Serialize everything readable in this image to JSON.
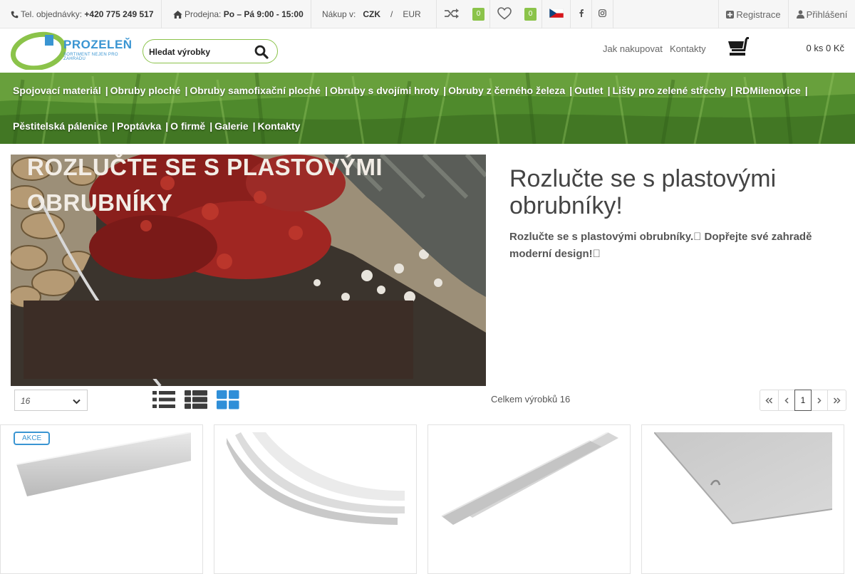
{
  "topbar": {
    "phone_label": "Tel. objednávky:",
    "phone_number": "+420 775 249 517",
    "shop_label": "Prodejna:",
    "shop_hours": "Po – Pá 9:00 - 15:00",
    "currency_label": "Nákup v:",
    "currency_selected": "CZK",
    "currency_separator": "/",
    "currency_other": "EUR",
    "compare_count": "0",
    "wishlist_count": "0",
    "register_label": "Registrace",
    "login_label": "Přihlášení"
  },
  "header": {
    "logo_name": "PROZELEŇ",
    "logo_tagline": "SORTIMENT NEJEN PRO ZAHRADU",
    "search_placeholder": "Hledat výrobky",
    "links": [
      "Jak nakupovat",
      "Kontakty"
    ],
    "cart_summary": "0 ks 0 Kč"
  },
  "menu": {
    "row1": [
      "Spojovací materiál",
      "Obruby ploché",
      "Obruby samofixační ploché",
      "Obruby s dvojími hroty",
      "Obruby z černého železa",
      "Outlet",
      "Lišty pro zelené střechy",
      "RDMilenovice"
    ],
    "row2": [
      "Pěstitelská pálenice",
      "Poptávka",
      "O firmě",
      "Galerie",
      "Kontakty"
    ],
    "separator": "|"
  },
  "hero": {
    "banner_line1": "ROZLUČTE SE S PLASTOVÝMI",
    "banner_line2": "OBRUBNÍKY",
    "title": "Rozlučte se s plastovými obrubníky!",
    "subtitle": "Rozlučte se s plastovými obrubníky.\u0000 Dopřejte své zahradě moderní design!\u0000"
  },
  "listing": {
    "per_page": "16",
    "total_label": "Celkem výrobků 16",
    "current_page": "1"
  },
  "products": [
    {
      "badge": "AKCE",
      "icon": "flat-edging-strip"
    },
    {
      "badge": "",
      "icon": "curved-edging-strips"
    },
    {
      "badge": "",
      "icon": "straight-edging-strips"
    },
    {
      "badge": "",
      "icon": "flat-sheet-edging"
    }
  ],
  "colors": {
    "accent_green": "#8bc34a",
    "brand_blue": "#3a95d2",
    "banner_brown": "#3c2d26"
  }
}
